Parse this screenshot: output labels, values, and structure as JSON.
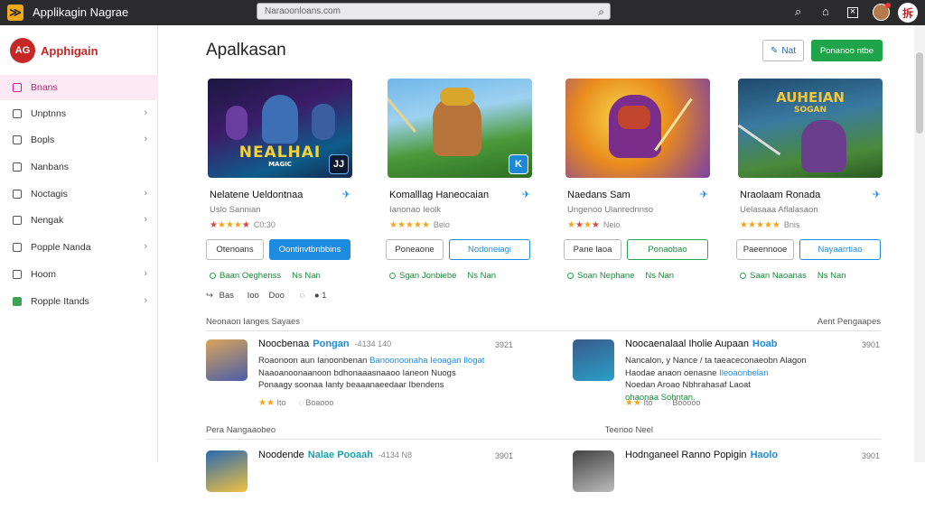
{
  "topbar": {
    "app_title": "Applikagin Nagrae",
    "search_placeholder": "Naraoonloans.com",
    "brand_badge": "拆"
  },
  "sidebar": {
    "brand_label": "Apphigain",
    "logo_text": "AG",
    "items": [
      {
        "label": "Bnans",
        "active": true
      },
      {
        "label": "Unptnns"
      },
      {
        "label": "Bopls"
      },
      {
        "label": "Nanbans"
      },
      {
        "label": "Noctagis"
      },
      {
        "label": "Nengak"
      },
      {
        "label": "Popple Nanda"
      },
      {
        "label": "Hoom"
      },
      {
        "label": "Ropple Itands"
      }
    ]
  },
  "main": {
    "title": "Apalkasan",
    "header_button_outline": "Nat",
    "header_button_primary": "Ponanoo ntbe",
    "cards": [
      {
        "thumb_text": "NEALHAI",
        "thumb_sub": "MAGIC",
        "badge": "JJ",
        "title": "Nelatene Ueldontnaa",
        "sub": "Uslo  Sannian",
        "rating": "4.0",
        "count": "C0:30",
        "btn1": "Otenoans",
        "btn2": "Oontinvtbnbbins",
        "btn2_style": "fill",
        "link1": "Baan Oeghenss",
        "link2": "Ns Nan",
        "actions": [
          "Bas",
          "Ioo",
          "Doo",
          "1"
        ]
      },
      {
        "thumb_text": "",
        "thumb_sub": "",
        "badge": "K",
        "title": "Komalllag Haneocaian",
        "sub": "Ianonao  Ieolk",
        "rating": "4.0",
        "count": "Beio",
        "btn1": "Poneaone",
        "btn2": "Nodoneiagi",
        "btn2_style": "outline-blue",
        "link1": "Sgan Jonbiebe",
        "link2": "Ns Nan",
        "actions": []
      },
      {
        "thumb_text": "",
        "thumb_sub": "",
        "badge": "",
        "title": "Naedans Sam",
        "sub": "Ungenoo  Ulanrednnso",
        "rating": "3.0",
        "count": "Neio",
        "btn1": "Pane  laoa",
        "btn2": "Ponaobao",
        "btn2_style": "outline-green",
        "link1": "Soan Nephane",
        "link2": "Ns Nan",
        "actions": []
      },
      {
        "thumb_text": "AUHEIAN",
        "thumb_sub": "SOGAN",
        "badge": "",
        "title": "Nraolaam Ronada",
        "sub": "Uelasaaa  Aflalasaon",
        "rating": "4.0",
        "count": "Bnis",
        "btn1": "Paeennooe",
        "btn2": "Nayaarrtiao",
        "btn2_style": "outline-blue",
        "link1": "Saan Naoanas",
        "link2": "Ns Nan",
        "actions": []
      }
    ],
    "section1": {
      "left": "Neonaon Ianges Sayaes",
      "right": "Aent Pengaapes"
    },
    "section2": {
      "left": "Pera Nangaaobeo",
      "right": "Teenoo Neel"
    },
    "reviews": [
      {
        "name": "Noocbenaa",
        "highlight": "Pongan",
        "meta": "-4134 140",
        "date": "3921",
        "body_a": "Roaonoon aun Ianoonbenan ",
        "body_b": "Banoonoonaha Ieoagan",
        "body_c": " Ilogat",
        "body_d": "Naaoanoonaanoon bdhonaaasnaaoo Ianeon Nuogs",
        "body_e": "Ponaagy  soonaa Ianty beaaanaeedaar Ibendens",
        "stars": "★★",
        "s1": "Ito",
        "s2": "Boaooo"
      },
      {
        "name": "Noocaenalaal Iholie Aupaan",
        "highlight": "Hoab",
        "meta": "",
        "date": "3901",
        "body_a": "Nancalon, y  Nance / ta taeaceconaeobn Alagon",
        "body_b": "Haodae anaon oenasne",
        "body_c": " Ileoaonbelan",
        "body_d": "Noedan Aroao Nbhrahasaf  Laoat",
        "body_e": "ohaonaa Sohntan.",
        "stars": "★★",
        "s1": "Ito",
        "s2": "Booooo"
      },
      {
        "name": "Noodende",
        "highlight": "Nalae Pooaah",
        "meta": "-4134  N8",
        "date": "3901",
        "body_a": "",
        "body_b": "",
        "body_c": "",
        "body_d": "",
        "body_e": "",
        "stars": "",
        "s1": "",
        "s2": ""
      },
      {
        "name": "Hodnganeel Ranno Popigin",
        "highlight": "Haolo",
        "meta": "",
        "date": "3901",
        "body_a": "",
        "body_b": "",
        "body_c": "",
        "body_d": "",
        "body_e": "",
        "stars": "",
        "s1": "",
        "s2": ""
      }
    ]
  },
  "colors": {
    "accent": "#1d8be0",
    "primary": "#1ea54b",
    "brand": "#c62828",
    "active_bg": "#fde9f4",
    "topbar": "#2b2b2e"
  }
}
